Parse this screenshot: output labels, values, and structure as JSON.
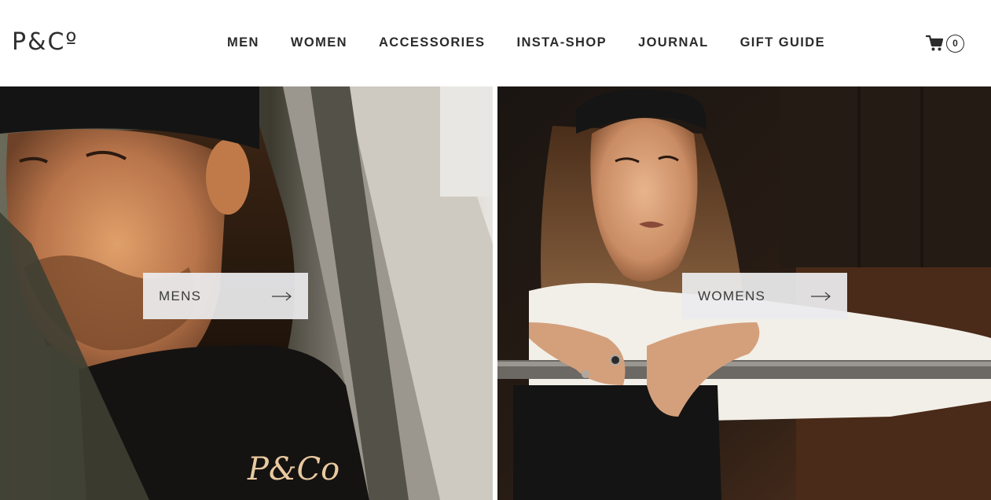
{
  "header": {
    "logo": "P&Cº",
    "nav": [
      {
        "label": "MEN"
      },
      {
        "label": "WOMEN"
      },
      {
        "label": "ACCESSORIES"
      },
      {
        "label": "INSTA-SHOP"
      },
      {
        "label": "JOURNAL"
      },
      {
        "label": "GIFT GUIDE"
      }
    ],
    "cart": {
      "icon": "cart-icon",
      "count": "0"
    }
  },
  "hero": {
    "left": {
      "cta_label": "MENS",
      "icon": "arrow-right-icon",
      "shirt_print": "P&Co"
    },
    "right": {
      "cta_label": "WOMENS",
      "icon": "arrow-right-icon"
    }
  },
  "colors": {
    "text": "#2b2b2b",
    "background": "#ffffff",
    "cta_background": "#ececee"
  }
}
